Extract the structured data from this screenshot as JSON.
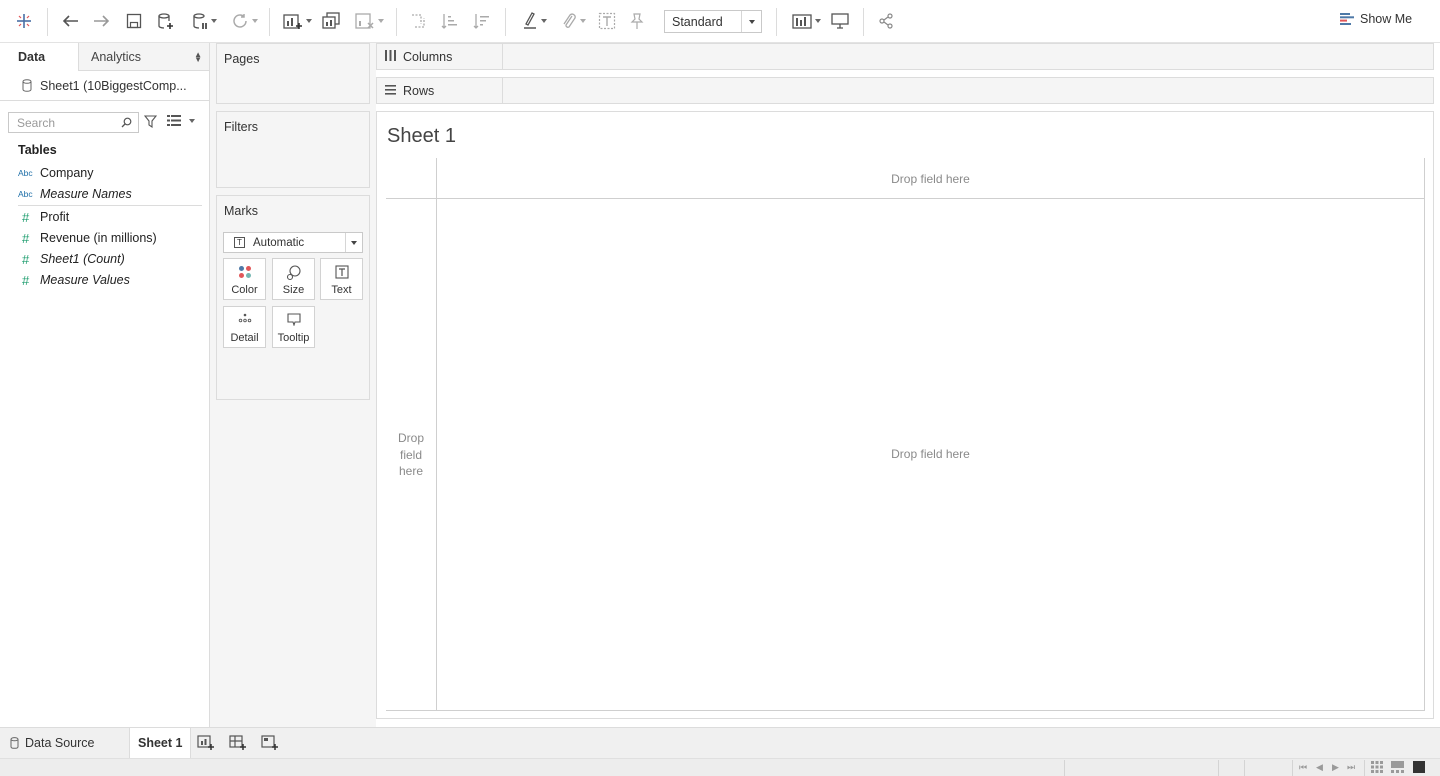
{
  "toolbar": {
    "standard_select": "Standard",
    "show_me": "Show Me",
    "icons": [
      "tableau-logo-icon",
      "undo-icon",
      "redo-icon",
      "save-icon",
      "new-datasource-icon",
      "pause-updates-icon",
      "refresh-icon",
      "new-worksheet-icon",
      "duplicate-sheet-icon",
      "clear-sheet-icon",
      "swap-rows-columns-icon",
      "sort-ascending-icon",
      "sort-descending-icon",
      "highlight-icon",
      "group-members-icon",
      "show-mark-labels-icon",
      "fix-axes-icon",
      "fit-width-icon",
      "presentation-mode-icon",
      "share-icon",
      "show-me-icon"
    ]
  },
  "left_pane": {
    "tabs": {
      "data": "Data",
      "analytics": "Analytics"
    },
    "datasource": "Sheet1 (10BiggestComp...",
    "search_placeholder": "Search",
    "tables_heading": "Tables",
    "dimensions": [
      {
        "type": "Abc",
        "name": "Company"
      },
      {
        "type": "Abc",
        "name": "Measure Names"
      }
    ],
    "measures": [
      {
        "type": "#",
        "name": "Profit"
      },
      {
        "type": "#",
        "name": "Revenue (in millions)"
      },
      {
        "type": "#",
        "name": "Sheet1 (Count)"
      },
      {
        "type": "#",
        "name": "Measure Values"
      }
    ]
  },
  "cards": {
    "pages": "Pages",
    "filters": "Filters",
    "marks": "Marks",
    "marks_type": "Automatic",
    "mark_buttons": {
      "color": "Color",
      "size": "Size",
      "text": "Text",
      "detail": "Detail",
      "tooltip": "Tooltip"
    }
  },
  "shelves": {
    "columns": "Columns",
    "rows": "Rows"
  },
  "view": {
    "sheet_title": "Sheet 1",
    "drop_columns": "Drop field here",
    "drop_rows_line1": "Drop",
    "drop_rows_line2": "field",
    "drop_rows_line3": "here",
    "drop_center": "Drop field here"
  },
  "bottom_tabs": {
    "data_source": "Data Source",
    "sheet1": "Sheet 1",
    "icons": [
      "new-worksheet-tab-icon",
      "new-dashboard-tab-icon",
      "new-story-tab-icon"
    ]
  },
  "colors": {
    "dimension": "#1e6fa8",
    "measure": "#1f9e6f",
    "accent_blue": "#1f77b4"
  }
}
